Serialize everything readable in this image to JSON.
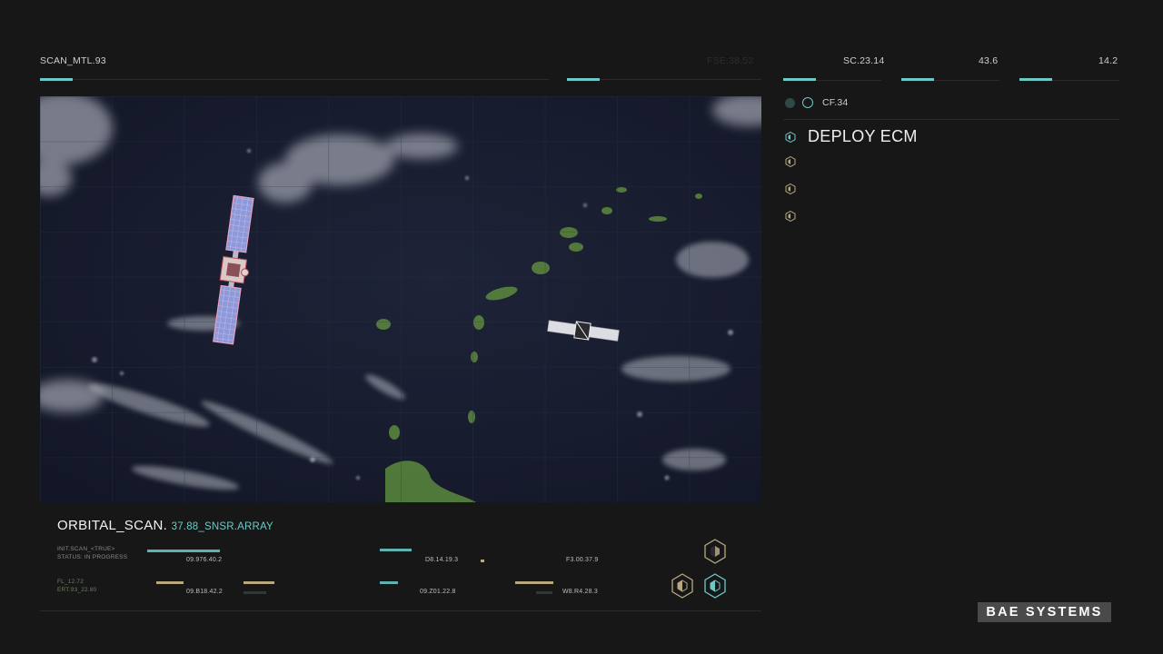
{
  "header": {
    "left_label": "SCAN_MTL.93",
    "faded_label": "FSE.38.52",
    "stats": [
      "SC.23.14",
      "43.6",
      "14.2"
    ]
  },
  "panel": {
    "toggle_label": "CF.34",
    "menu": [
      {
        "label": "DEPLOY ECM",
        "active": true
      },
      {
        "label": "",
        "active": false
      },
      {
        "label": "",
        "active": false
      },
      {
        "label": "",
        "active": false
      }
    ]
  },
  "footer": {
    "title": "ORBITAL_SCAN.",
    "subtitle": "37.88_SNSR.ARRAY",
    "row1": {
      "label_a": "INIT.SCAN_<TRUE>",
      "label_b": "STATUS: IN PROGRESS",
      "values": [
        "09.976.40.2",
        "D8.14.19.3",
        "F3.00.37.9"
      ]
    },
    "row2": {
      "label_a": "FL_12.72",
      "label_b": "ERT.93_22.80",
      "values": [
        "09.B18.42.2",
        "09.Z01.22.8",
        "W8.R4.28.3"
      ]
    }
  },
  "brand": {
    "logo": "BAE SYSTEMS"
  },
  "colors": {
    "accent": "#6ec9c6",
    "tan": "#b7a880",
    "background": "#171717"
  },
  "icons": [
    "hexagon-icon",
    "radio-circle-icon",
    "satellite-icon"
  ]
}
